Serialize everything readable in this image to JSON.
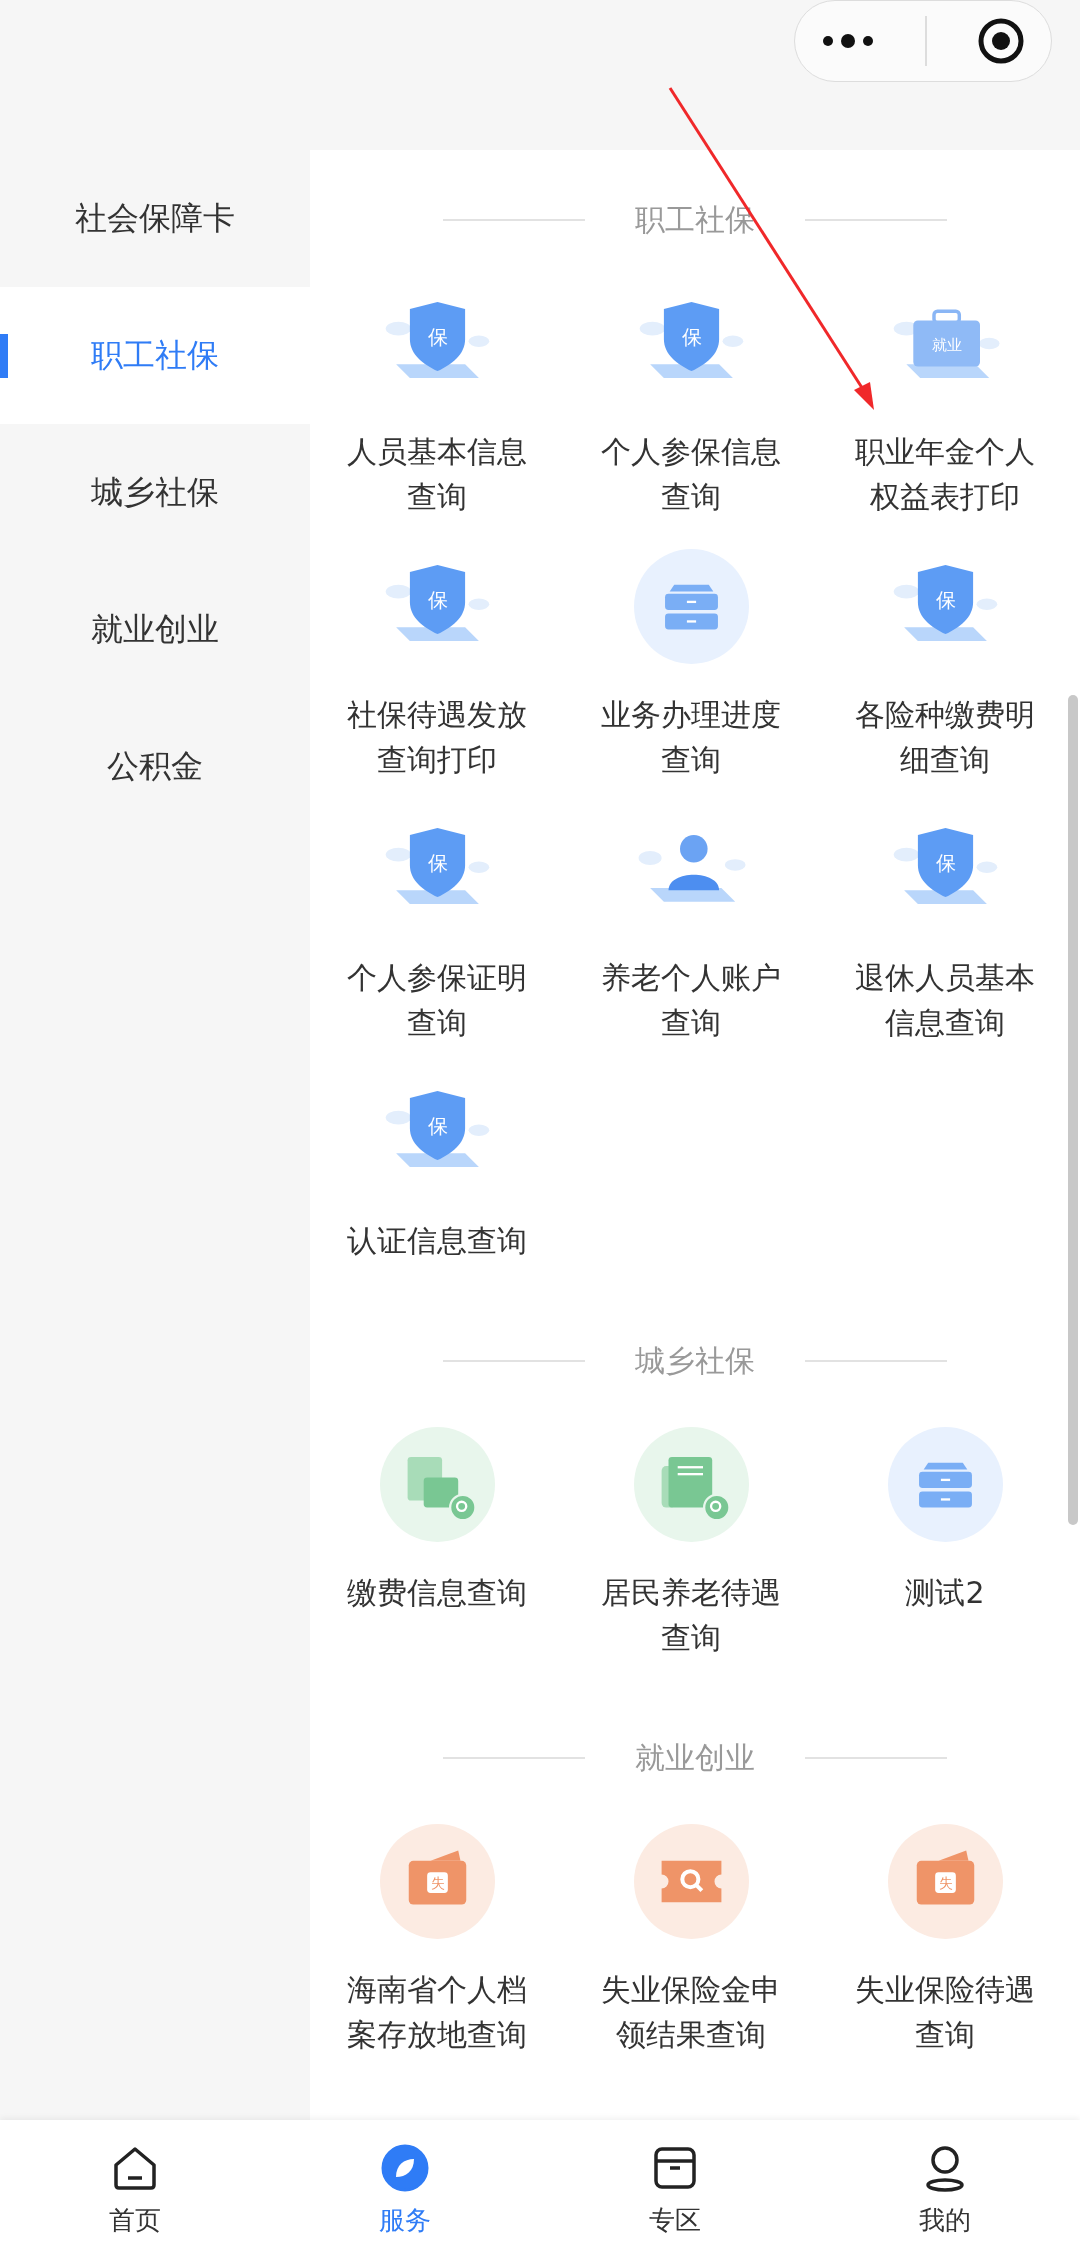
{
  "sidebar": [
    {
      "label": "社会保障卡",
      "selected": false
    },
    {
      "label": "职工社保",
      "selected": true
    },
    {
      "label": "城乡社保",
      "selected": false
    },
    {
      "label": "就业创业",
      "selected": false
    },
    {
      "label": "公积金",
      "selected": false
    }
  ],
  "sections": [
    {
      "title": "职工社保",
      "items": [
        {
          "label": "人员基本信息查询",
          "kind": "shield",
          "glyph": "保"
        },
        {
          "label": "个人参保信息查询",
          "kind": "shield",
          "glyph": "保"
        },
        {
          "label": "职业年金个人权益表打印",
          "kind": "briefcase",
          "glyph": "就业"
        },
        {
          "label": "社保待遇发放查询打印",
          "kind": "shield",
          "glyph": "保"
        },
        {
          "label": "业务办理进度查询",
          "kind": "drawer"
        },
        {
          "label": "各险种缴费明细查询",
          "kind": "shield",
          "glyph": "保"
        },
        {
          "label": "个人参保证明查询",
          "kind": "shield",
          "glyph": "保"
        },
        {
          "label": "养老个人账户查询",
          "kind": "person"
        },
        {
          "label": "退休人员基本信息查询",
          "kind": "shield",
          "glyph": "保"
        },
        {
          "label": "认证信息查询",
          "kind": "shield",
          "glyph": "保"
        }
      ]
    },
    {
      "title": "城乡社保",
      "items": [
        {
          "label": "缴费信息查询",
          "kind": "bill"
        },
        {
          "label": "居民养老待遇查询",
          "kind": "ledger"
        },
        {
          "label": "测试2",
          "kind": "drawer"
        }
      ]
    },
    {
      "title": "就业创业",
      "items": [
        {
          "label": "海南省个人档案存放地查询",
          "kind": "wallet",
          "glyph": "失"
        },
        {
          "label": "失业保险金申领结果查询",
          "kind": "ticket"
        },
        {
          "label": "失业保险待遇查询",
          "kind": "wallet",
          "glyph": "失"
        }
      ]
    }
  ],
  "nav": [
    {
      "label": "首页",
      "kind": "home",
      "selected": false
    },
    {
      "label": "服务",
      "kind": "compass",
      "selected": true
    },
    {
      "label": "专区",
      "kind": "box",
      "selected": false
    },
    {
      "label": "我的",
      "kind": "user",
      "selected": false
    }
  ]
}
